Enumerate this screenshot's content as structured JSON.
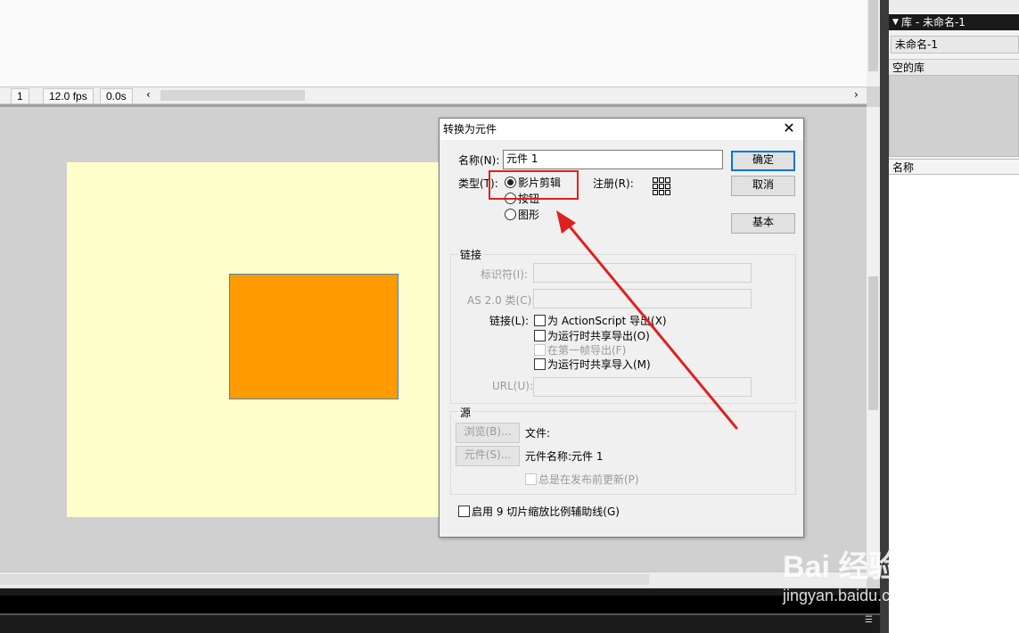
{
  "timeline": {
    "frame": "1",
    "fps": "12.0 fps",
    "time": "0.0s",
    "left_arrow": "‹",
    "right_arrow": "›"
  },
  "library": {
    "header": "库 - 未命名-1",
    "document": "未命名-1",
    "empty_label": "空的库",
    "name_column": "名称"
  },
  "dialog": {
    "title": "转换为元件",
    "close_glyph": "✕",
    "name_label": "名称(N):",
    "name_value": "元件 1",
    "ok_button": "确定",
    "cancel_button": "取消",
    "basic_button": "基本",
    "type_label": "类型(T):",
    "type_options": [
      "影片剪辑",
      "按钮",
      "图形"
    ],
    "selected_type": "影片剪辑",
    "registration_label": "注册(R):",
    "linkage": {
      "section_title": "链接",
      "identifier_label": "标识符(I):",
      "as2_class_label": "AS 2.0 类(C):",
      "linkage_label": "链接(L):",
      "export_actionscript": "为 ActionScript 导出(X)",
      "export_runtime_share": "为运行时共享导出(O)",
      "export_first_frame": "在第一帧导出(F)",
      "import_runtime_share": "为运行时共享导入(M)",
      "url_label": "URL(U):"
    },
    "source": {
      "section_title": "源",
      "browse_button": "浏览(B)...",
      "symbol_button": "元件(S)...",
      "file_label": "文件:",
      "symbol_name_label": "元件名称:元件 1",
      "always_update": "总是在发布前更新(P)"
    },
    "nine_slice": "启用 9 切片缩放比例辅助线(G)"
  },
  "watermark": {
    "logo": "Bai 经验",
    "url": "jingyan.baidu.com"
  },
  "colors": {
    "stage": "#ffffcc",
    "shape_fill": "#ff9a00",
    "annotation": "#e02020"
  }
}
